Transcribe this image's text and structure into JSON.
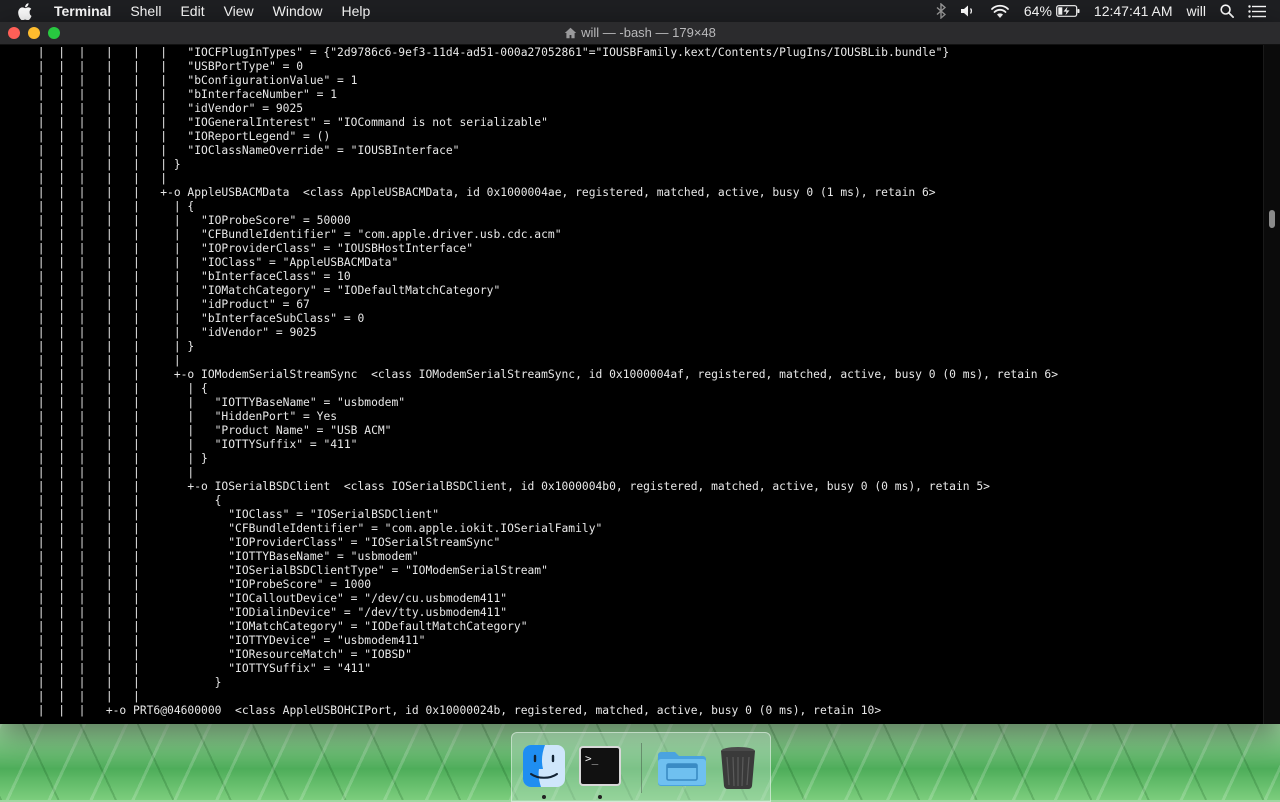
{
  "menubar": {
    "app_name": "Terminal",
    "menus": [
      "Shell",
      "Edit",
      "View",
      "Window",
      "Help"
    ],
    "battery": "64%",
    "clock": "12:47:41 AM",
    "user": "will",
    "status_icons": [
      "bluetooth-icon",
      "volume-icon",
      "wifi-icon",
      "battery-icon",
      "spotlight-icon",
      "notification-center-icon"
    ]
  },
  "window": {
    "title": "will — -bash — 179×48"
  },
  "terminal": {
    "lines": [
      " |  |  |   |   |   |   \"IOCFPlugInTypes\" = {\"2d9786c6-9ef3-11d4-ad51-000a27052861\"=\"IOUSBFamily.kext/Contents/PlugIns/IOUSBLib.bundle\"}",
      " |  |  |   |   |   |   \"USBPortType\" = 0",
      " |  |  |   |   |   |   \"bConfigurationValue\" = 1",
      " |  |  |   |   |   |   \"bInterfaceNumber\" = 1",
      " |  |  |   |   |   |   \"idVendor\" = 9025",
      " |  |  |   |   |   |   \"IOGeneralInterest\" = \"IOCommand is not serializable\"",
      " |  |  |   |   |   |   \"IOReportLegend\" = ()",
      " |  |  |   |   |   |   \"IOClassNameOverride\" = \"IOUSBInterface\"",
      " |  |  |   |   |   | }",
      " |  |  |   |   |   |",
      " |  |  |   |   |   +-o AppleUSBACMData  <class AppleUSBACMData, id 0x1000004ae, registered, matched, active, busy 0 (1 ms), retain 6>",
      " |  |  |   |   |     | {",
      " |  |  |   |   |     |   \"IOProbeScore\" = 50000",
      " |  |  |   |   |     |   \"CFBundleIdentifier\" = \"com.apple.driver.usb.cdc.acm\"",
      " |  |  |   |   |     |   \"IOProviderClass\" = \"IOUSBHostInterface\"",
      " |  |  |   |   |     |   \"IOClass\" = \"AppleUSBACMData\"",
      " |  |  |   |   |     |   \"bInterfaceClass\" = 10",
      " |  |  |   |   |     |   \"IOMatchCategory\" = \"IODefaultMatchCategory\"",
      " |  |  |   |   |     |   \"idProduct\" = 67",
      " |  |  |   |   |     |   \"bInterfaceSubClass\" = 0",
      " |  |  |   |   |     |   \"idVendor\" = 9025",
      " |  |  |   |   |     | }",
      " |  |  |   |   |     |",
      " |  |  |   |   |     +-o IOModemSerialStreamSync  <class IOModemSerialStreamSync, id 0x1000004af, registered, matched, active, busy 0 (0 ms), retain 6>",
      " |  |  |   |   |       | {",
      " |  |  |   |   |       |   \"IOTTYBaseName\" = \"usbmodem\"",
      " |  |  |   |   |       |   \"HiddenPort\" = Yes",
      " |  |  |   |   |       |   \"Product Name\" = \"USB ACM\"",
      " |  |  |   |   |       |   \"IOTTYSuffix\" = \"411\"",
      " |  |  |   |   |       | }",
      " |  |  |   |   |       |",
      " |  |  |   |   |       +-o IOSerialBSDClient  <class IOSerialBSDClient, id 0x1000004b0, registered, matched, active, busy 0 (0 ms), retain 5>",
      " |  |  |   |   |           {",
      " |  |  |   |   |             \"IOClass\" = \"IOSerialBSDClient\"",
      " |  |  |   |   |             \"CFBundleIdentifier\" = \"com.apple.iokit.IOSerialFamily\"",
      " |  |  |   |   |             \"IOProviderClass\" = \"IOSerialStreamSync\"",
      " |  |  |   |   |             \"IOTTYBaseName\" = \"usbmodem\"",
      " |  |  |   |   |             \"IOSerialBSDClientType\" = \"IOModemSerialStream\"",
      " |  |  |   |   |             \"IOProbeScore\" = 1000",
      " |  |  |   |   |             \"IOCalloutDevice\" = \"/dev/cu.usbmodem411\"",
      " |  |  |   |   |             \"IODialinDevice\" = \"/dev/tty.usbmodem411\"",
      " |  |  |   |   |             \"IOMatchCategory\" = \"IODefaultMatchCategory\"",
      " |  |  |   |   |             \"IOTTYDevice\" = \"usbmodem411\"",
      " |  |  |   |   |             \"IOResourceMatch\" = \"IOBSD\"",
      " |  |  |   |   |             \"IOTTYSuffix\" = \"411\"",
      " |  |  |   |   |           }",
      " |  |  |   |   |",
      " |  |  |   +-o PRT6@04600000  <class AppleUSBOHCIPort, id 0x10000024b, registered, matched, active, busy 0 (0 ms), retain 10>"
    ],
    "scroll_position": 0.25
  },
  "dock": {
    "items": [
      {
        "name": "Finder",
        "icon": "finder-icon",
        "running": true
      },
      {
        "name": "Terminal",
        "icon": "terminal-icon",
        "running": true
      },
      {
        "name": "Downloads",
        "icon": "folder-icon",
        "running": false
      },
      {
        "name": "Trash",
        "icon": "trash-icon",
        "running": false
      }
    ],
    "terminal_glyph": ">_"
  },
  "colors": {
    "menubar_bg": "#1e1f22",
    "terminal_bg": "#000000",
    "terminal_fg": "#e8e8e8",
    "close": "#ff5f57",
    "minimize": "#febc2e",
    "zoom": "#28c840"
  }
}
